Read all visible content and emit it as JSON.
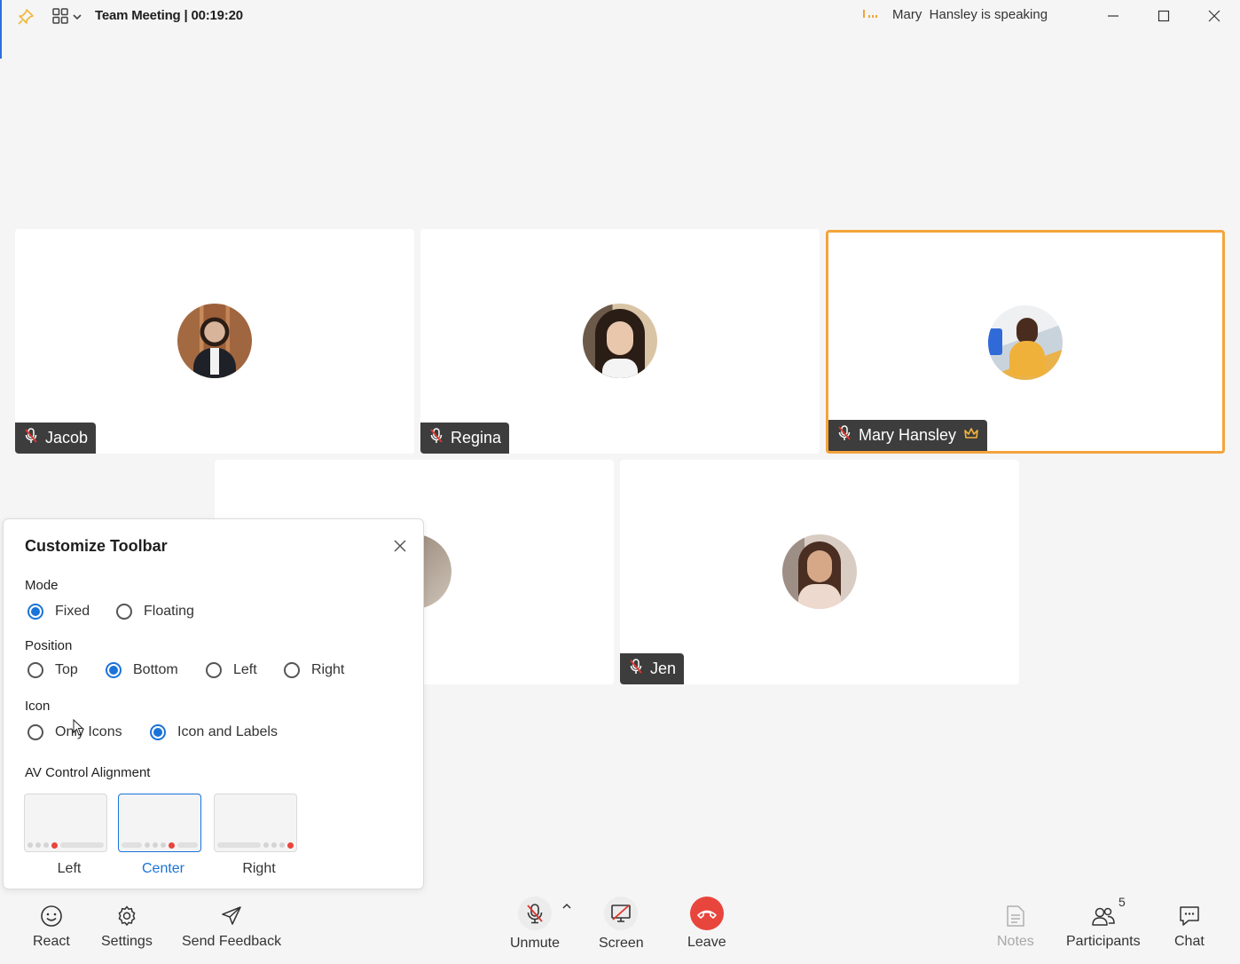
{
  "titlebar": {
    "meeting_title": "Team Meeting | 00:19:20",
    "speaking_status": "Mary  Hansley is speaking"
  },
  "participants": [
    {
      "name": "Jacob",
      "muted": true
    },
    {
      "name": "Regina",
      "muted": true
    },
    {
      "name": "Mary Hansley",
      "muted": true,
      "host": true,
      "active_speaker": true
    },
    {
      "name": "",
      "muted": true
    },
    {
      "name": "Jen",
      "muted": true
    }
  ],
  "customize_toolbar": {
    "title": "Customize Toolbar",
    "mode": {
      "label": "Mode",
      "options": [
        "Fixed",
        "Floating"
      ],
      "selected": "Fixed"
    },
    "position": {
      "label": "Position",
      "options": [
        "Top",
        "Bottom",
        "Left",
        "Right"
      ],
      "selected": "Bottom"
    },
    "icon": {
      "label": "Icon",
      "options": [
        "Only Icons",
        "Icon and Labels"
      ],
      "selected": "Icon and Labels"
    },
    "alignment": {
      "label": "AV Control Alignment",
      "options": [
        "Left",
        "Center",
        "Right"
      ],
      "selected": "Center"
    }
  },
  "toolbar": {
    "react": "React",
    "settings": "Settings",
    "feedback": "Send Feedback",
    "unmute": "Unmute",
    "screen": "Screen",
    "leave": "Leave",
    "notes": "Notes",
    "participants": "Participants",
    "participants_count": "5",
    "chat": "Chat"
  },
  "colors": {
    "accent": "#1a73d9",
    "active_border": "#f3a43b",
    "leave": "#e8453c",
    "mute_red": "#e0372f"
  }
}
